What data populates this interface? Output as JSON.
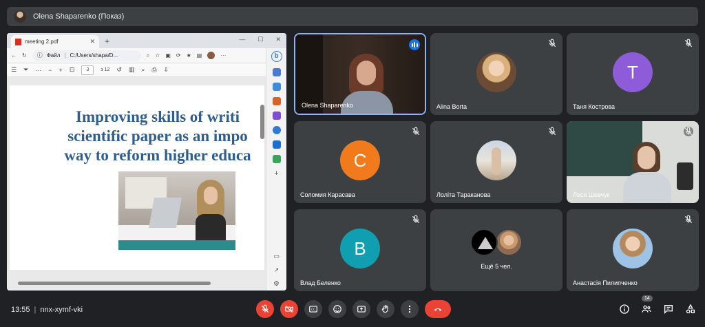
{
  "header": {
    "presenter_title": "Olena Shaparenko (Показ)"
  },
  "browser": {
    "tab_label": "meeting 2.pdf",
    "file_label": "Файл",
    "url": "C:/Users/shapa/D...",
    "page_current": "3",
    "page_total": "з 12"
  },
  "slide": {
    "title_line1": "Improving skills of writi",
    "title_line2": "scientific paper as an impo",
    "title_line3": "way to reform higher educa"
  },
  "participants": [
    {
      "name": "Olena Shaparenko"
    },
    {
      "name": "Alina Borta"
    },
    {
      "name": "Таня Кострова",
      "initial": "T",
      "color": "#8e5cd9"
    },
    {
      "name": "Соломия Карасава",
      "initial": "C",
      "color": "#f07a1c"
    },
    {
      "name": "Лоліта Тараканова"
    },
    {
      "name": "Леся Шевчук"
    },
    {
      "name": "Влад Беленко",
      "initial": "B",
      "color": "#0f9fb1"
    },
    {
      "name": ""
    },
    {
      "name": "Анастасія Пилипченко"
    }
  ],
  "more": {
    "label": "Ещё 5 чел."
  },
  "bottom": {
    "time": "13:55",
    "meeting_code": "nnx-xymf-vki",
    "participant_count": "14"
  },
  "icons": [
    "mic-off-icon",
    "camera-off-icon",
    "captions-icon",
    "emoji-icon",
    "present-icon",
    "raise-hand-icon",
    "more-icon",
    "hangup-icon",
    "info-icon",
    "people-icon",
    "chat-icon",
    "activities-icon"
  ],
  "colors": {
    "accent": "#8ab4f8",
    "danger": "#ea4335",
    "speaking": "#1a73e8"
  }
}
